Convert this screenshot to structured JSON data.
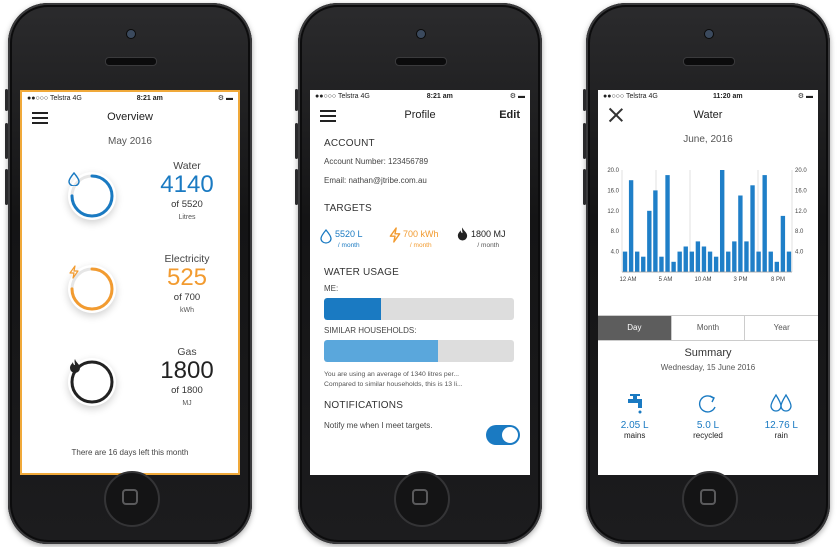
{
  "colors": {
    "water": "#1a7ac2",
    "electricity": "#f29b30",
    "gas": "#222222",
    "bar": "#1f7fc8",
    "ring_bg": "#e6e6e6"
  },
  "status": {
    "carrier": "●●○○○ Telstra  4G"
  },
  "overview": {
    "time": "8:21 am",
    "title": "Overview",
    "month": "May 2016",
    "utilities": [
      {
        "name": "Water",
        "value": "4140",
        "of": "of 5520",
        "unit": "Litres",
        "progress": 0.75,
        "icon": "water-drop-icon"
      },
      {
        "name": "Electricity",
        "value": "525",
        "of": "of 700",
        "unit": "kWh",
        "progress": 0.75,
        "icon": "lightning-icon"
      },
      {
        "name": "Gas",
        "value": "1800",
        "of": "of 1800",
        "unit": "MJ",
        "progress": 1.0,
        "icon": "flame-icon"
      }
    ],
    "footer": "There are 16 days left this month"
  },
  "profile": {
    "time": "8:21 am",
    "title": "Profile",
    "edit": "Edit",
    "account_heading": "ACCOUNT",
    "account_number": "Account Number: 123456789",
    "email": "Email: nathan@jtribe.com.au",
    "targets_heading": "TARGETS",
    "targets": [
      {
        "value": "5520 L",
        "period": "/ month",
        "icon": "water-drop-icon"
      },
      {
        "value": "700 kWh",
        "period": "/ month",
        "icon": "lightning-icon"
      },
      {
        "value": "1800 MJ",
        "period": "/ month",
        "icon": "flame-icon"
      }
    ],
    "usage_heading": "WATER USAGE",
    "me_label": "ME:",
    "me_fraction": 0.3,
    "similar_label": "SIMILAR HOUSEHOLDS:",
    "similar_fraction": 0.6,
    "note_line1": "You are using an average of 1340 litres per...",
    "note_line2": "Compared to similar households, this is 13 li...",
    "notifications_heading": "NOTIFICATIONS",
    "notify_text": "Notify me when I meet targets.",
    "notify_on": true
  },
  "water": {
    "time": "11:20 am",
    "title": "Water",
    "date": "June, 2016",
    "tabs": [
      "Day",
      "Month",
      "Year"
    ],
    "active_tab": "Day",
    "summary_title": "Summary",
    "summary_date": "Wednesday, 15 June 2016",
    "stats": [
      {
        "value": "2.05 L",
        "label": "mains",
        "icon": "tap-icon"
      },
      {
        "value": "5.0 L",
        "label": "recycled",
        "icon": "recycle-arrow-icon"
      },
      {
        "value": "12.76 L",
        "label": "rain",
        "icon": "rain-drops-icon"
      }
    ]
  },
  "chart_data": {
    "type": "bar",
    "ylim": [
      0,
      20
    ],
    "yticks": [
      "20.0",
      "16.0",
      "12.0",
      "8.0",
      "4.0"
    ],
    "xticks": [
      "12 AM",
      "5 AM",
      "10 AM",
      "3 PM",
      "8 PM"
    ],
    "values": [
      4,
      18,
      4,
      3,
      12,
      16,
      3,
      19,
      2,
      4,
      5,
      4,
      6,
      5,
      4,
      3,
      20,
      4,
      6,
      15,
      6,
      17,
      4,
      19,
      4,
      2,
      11,
      4
    ],
    "grid": true
  }
}
